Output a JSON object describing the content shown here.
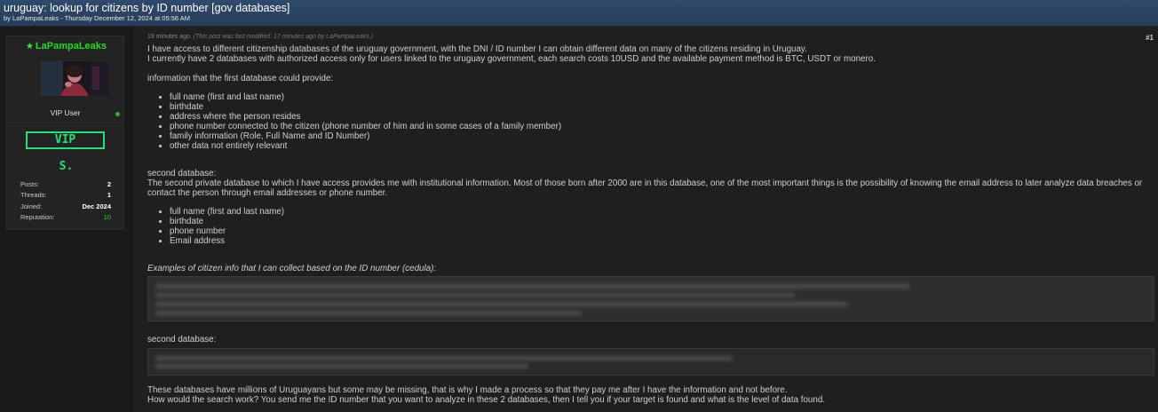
{
  "thread": {
    "title": "uruguay: lookup for citizens by ID number [gov databases]",
    "byline": "by LaPampaLeaks - Thursday December 12, 2024 at 05:56 AM"
  },
  "author": {
    "username": "LaPampaLeaks",
    "user_title": "VIP User",
    "vip_badge": "VIP",
    "second_badge": "S.",
    "stats": [
      {
        "label": "Posts:",
        "value": "2"
      },
      {
        "label": "Threads:",
        "value": "1"
      },
      {
        "label": "Joined:",
        "value": "Dec 2024"
      },
      {
        "label": "Reputation:",
        "value": "10"
      }
    ],
    "icons": {
      "star": "star-icon",
      "online": "online-status-icon"
    },
    "colors": {
      "username": "#1ee01e",
      "badge": "#22e07a",
      "header": "#2f4a6b"
    }
  },
  "post": {
    "time": "19 minutes ago.",
    "edited": "(This post was last modified: 17 minutes ago by LaPampaLeaks.)",
    "number": "#1",
    "intro_1": "I have access to different citizenship databases of the uruguay government, with the DNI / ID number I can obtain different data on many of the citizens residing in Uruguay.",
    "intro_2": "I currently have 2 databases with authorized access only for users linked to the uruguay government, each search costs 10USD and the available payment method is BTC, USDT or monero.",
    "first_db_heading": "information that the first database could provide:",
    "first_db_items": [
      "full name (first and last name)",
      "birthdate",
      "address where the person resides",
      "phone number connected to the citizen (phone number of him and in some cases of a family member)",
      "family information (Role, Full Name and ID Number)",
      "other data not entirely relevant"
    ],
    "second_db_heading": "second database:",
    "second_db_desc": "The second private database to which I have access provides me with institutional information. Most of those born after 2000 are in this database, one of the most important things is the possibility of knowing the email address to later analyze data breaches or contact the person through email addresses or phone number.",
    "second_db_items": [
      "full name (first and last name)",
      "birthdate",
      "phone number",
      "Email address"
    ],
    "examples_heading": "Examples of citizen info that I can collect based on the ID number (cedula):",
    "second_db_label": "second database:",
    "outro_1": "These databases have millions of Uruguayans but some may be missing, that is why I made a process so that they pay me after I have the information and not before.",
    "outro_2": "How would the search work? You send me the ID number that you want to analyze in these 2 databases, then I tell you if your target is found and what is the level of data found."
  }
}
